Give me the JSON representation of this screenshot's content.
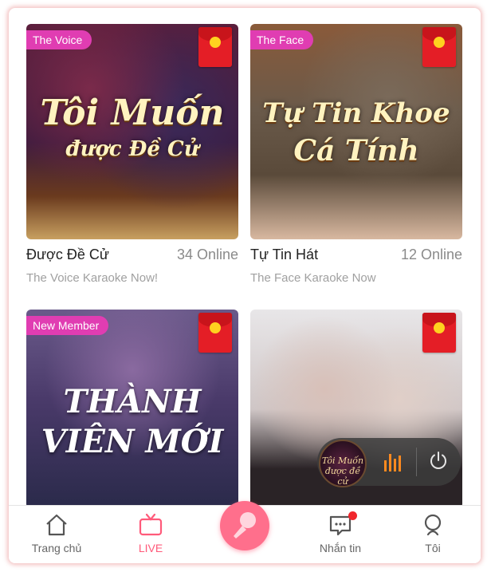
{
  "cards": [
    {
      "tag": "The Voice",
      "poster_line1": "Tôi Muốn",
      "poster_line2": "được Đề Cử",
      "title": "Được Đề Cử",
      "online": "34 Online",
      "subtitle": "The Voice Karaoke Now!"
    },
    {
      "tag": "The Face",
      "poster_line1": "Tự Tin Khoe",
      "poster_line2": "Cá Tính",
      "title": "Tự Tin Hát",
      "online": "12 Online",
      "subtitle": "The Face Karaoke Now"
    },
    {
      "tag": "New Member",
      "poster_line1": "THÀNH",
      "poster_line2": "VIÊN MỚI"
    },
    {
      "mini_player_disc_text": "Tôi Muốn được đề cử"
    }
  ],
  "tabbar": {
    "items": [
      {
        "label": "Trang chủ",
        "icon": "home-icon"
      },
      {
        "label": "LIVE",
        "icon": "tv-icon",
        "active": true
      },
      {
        "label": "",
        "icon": "microphone-icon"
      },
      {
        "label": "Nhắn tin",
        "icon": "message-icon",
        "badge": true
      },
      {
        "label": "Tôi",
        "icon": "profile-icon"
      }
    ]
  },
  "colors": {
    "accent": "#ff5a7a",
    "tag": "#e03db2",
    "envelope": "#e41e26"
  }
}
